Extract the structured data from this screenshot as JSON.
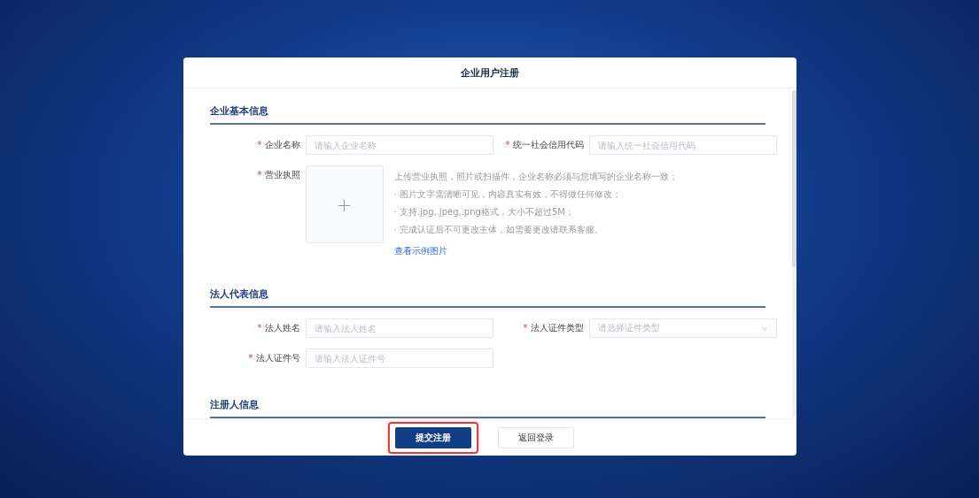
{
  "dialog": {
    "title": "企业用户注册"
  },
  "sections": [
    {
      "title": "企业基本信息",
      "rows": [
        [
          {
            "kind": "input",
            "label": "企业名称",
            "mark": "*",
            "placeholder": "请输入企业名称"
          },
          {
            "kind": "input",
            "label": "统一社会信用代码",
            "mark": "*",
            "placeholder": "请输入统一社会信用代码"
          }
        ],
        [
          {
            "kind": "upload",
            "label": "营业执照",
            "mark": "*",
            "plus": "+",
            "notes": [
              "上传营业执照，照片或扫描件，企业名称必须与您填写的企业名称一致；",
              "· 图片文字需清晰可见，内容真实有效，不得做任何修改；",
              "· 支持.jpg,.jpeg,.png格式，大小不超过5M；",
              "· 完成认证后不可更改主体，如需要更改请联系客服。"
            ],
            "link": "查看示例图片"
          }
        ]
      ]
    },
    {
      "title": "法人代表信息",
      "rows": [
        [
          {
            "kind": "input",
            "label": "法人姓名",
            "mark": "*",
            "placeholder": "请输入法人姓名"
          },
          {
            "kind": "select",
            "label": "法人证件类型",
            "mark": "*",
            "placeholder": "请选择证件类型"
          }
        ],
        [
          {
            "kind": "input",
            "label": "法人证件号",
            "mark": "*",
            "placeholder": "请输入法人证件号"
          }
        ]
      ]
    },
    {
      "title": "注册人信息"
    }
  ],
  "buttons": [
    {
      "label": "提交注册",
      "kind": "primary",
      "highlighted": true
    },
    {
      "label": "返回登录",
      "kind": "default",
      "highlighted": false
    }
  ]
}
